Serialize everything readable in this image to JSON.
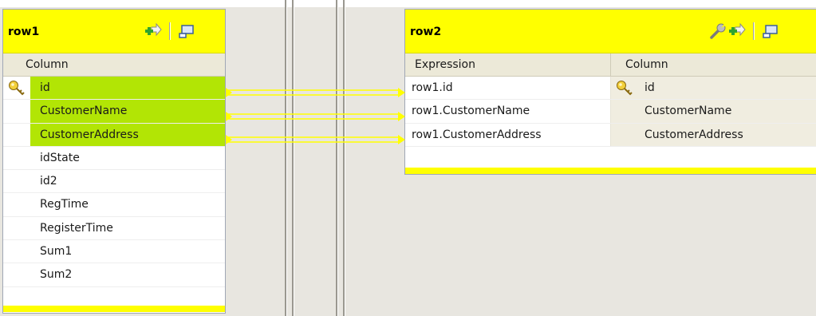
{
  "row1": {
    "title": "row1",
    "column_header": "Column",
    "rows": [
      {
        "name": "id",
        "key": true,
        "highlighted": true
      },
      {
        "name": "CustomerName",
        "key": false,
        "highlighted": true
      },
      {
        "name": "CustomerAddress",
        "key": false,
        "highlighted": true
      },
      {
        "name": "idState",
        "key": false,
        "highlighted": false
      },
      {
        "name": "id2",
        "key": false,
        "highlighted": false
      },
      {
        "name": "RegTime",
        "key": false,
        "highlighted": false
      },
      {
        "name": "RegisterTime",
        "key": false,
        "highlighted": false
      },
      {
        "name": "Sum1",
        "key": false,
        "highlighted": false
      },
      {
        "name": "Sum2",
        "key": false,
        "highlighted": false
      }
    ]
  },
  "row2": {
    "title": "row2",
    "expression_header": "Expression",
    "column_header": "Column",
    "rows": [
      {
        "expression": "row1.id",
        "name": "id",
        "key": true
      },
      {
        "expression": "row1.CustomerName",
        "name": "CustomerName",
        "key": false
      },
      {
        "expression": "row1.CustomerAddress",
        "name": "CustomerAddress",
        "key": false
      }
    ]
  },
  "colors": {
    "header_yellow": "#ffff00",
    "highlight_green": "#b2e505",
    "link_yellow": "#ffff00"
  },
  "icons": [
    "add-column-icon",
    "minimize-icon",
    "wrench-icon",
    "key-icon"
  ]
}
